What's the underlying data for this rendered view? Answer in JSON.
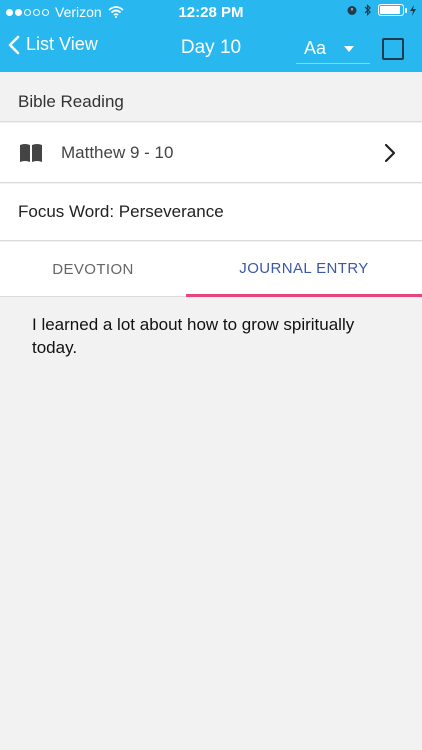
{
  "status_bar": {
    "carrier": "Verizon",
    "time": "12:28 PM",
    "signal_bars": 5,
    "signal_filled": 2,
    "battery_level": 0.9
  },
  "nav": {
    "back_label": "List View",
    "title": "Day 10",
    "font_size_label": "Aa",
    "colors": {
      "bar": "#29b7ef",
      "text": "#ffffff"
    }
  },
  "section": {
    "title": "Bible Reading"
  },
  "reading": {
    "passage": "Matthew 9 - 10",
    "icon": "book-icon"
  },
  "focus": {
    "text": "Focus Word: Perseverance"
  },
  "tabs": {
    "devotion": "DEVOTION",
    "journal": "JOURNAL ENTRY",
    "active": "journal",
    "colors": {
      "active_text": "#3b58a8",
      "underline": "#e8457a"
    }
  },
  "journal": {
    "text": "I learned a lot about how to grow spiritually today."
  }
}
